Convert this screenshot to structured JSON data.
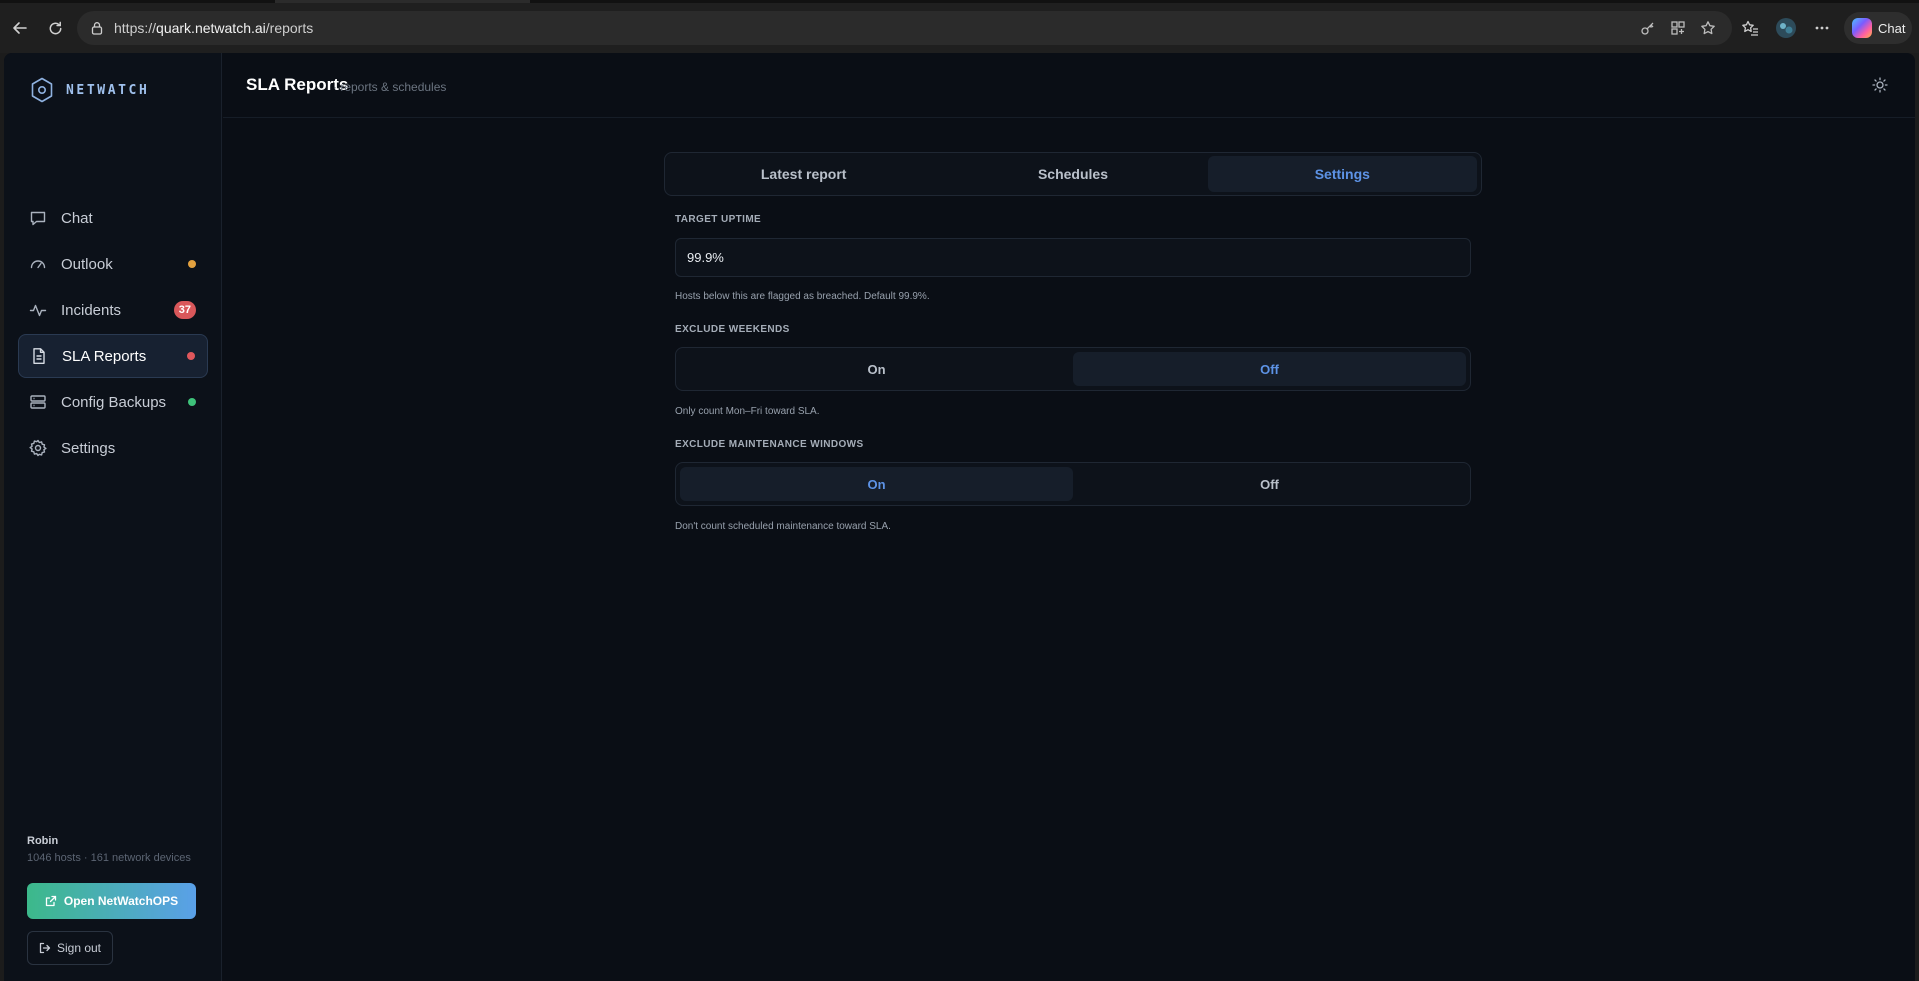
{
  "browser": {
    "url_prefix": "https://",
    "url_host": "quark.netwatch.ai",
    "url_path": "/reports",
    "chat_label": "Chat"
  },
  "brand": {
    "name": "NETWATCH"
  },
  "sidebar": {
    "items": [
      {
        "label": "Chat",
        "icon": "chat-icon"
      },
      {
        "label": "Outlook",
        "icon": "gauge-icon",
        "status": "orange"
      },
      {
        "label": "Incidents",
        "icon": "activity-icon",
        "badge": "37"
      },
      {
        "label": "SLA Reports",
        "icon": "document-icon",
        "status": "red",
        "active": true
      },
      {
        "label": "Config Backups",
        "icon": "database-icon",
        "status": "green"
      },
      {
        "label": "Settings",
        "icon": "gear-icon"
      }
    ],
    "user": {
      "name": "Robin",
      "summary": "1046 hosts · 161 network devices"
    },
    "open_ops_label": "Open NetWatchOPS",
    "sign_out_label": "Sign out"
  },
  "header": {
    "title": "SLA Reports",
    "subtitle": "· reports & schedules"
  },
  "tabs": [
    {
      "label": "Latest report"
    },
    {
      "label": "Schedules"
    },
    {
      "label": "Settings",
      "active": true
    }
  ],
  "settings": {
    "target_uptime": {
      "label": "TARGET UPTIME",
      "value": "99.9%",
      "hint": "Hosts below this are flagged as breached. Default 99.9%."
    },
    "exclude_weekends": {
      "label": "EXCLUDE WEEKENDS",
      "on_label": "On",
      "off_label": "Off",
      "selected": "Off",
      "hint": "Only count Mon–Fri toward SLA."
    },
    "exclude_maintenance": {
      "label": "EXCLUDE MAINTENANCE WINDOWS",
      "on_label": "On",
      "off_label": "Off",
      "selected": "On",
      "hint": "Don't count scheduled maintenance toward SLA."
    }
  },
  "colors": {
    "accent": "#5d93e6",
    "status_orange": "#e3a13f",
    "status_red": "#e0575c",
    "status_green": "#3ec27a",
    "badge_red": "#d9575a"
  }
}
